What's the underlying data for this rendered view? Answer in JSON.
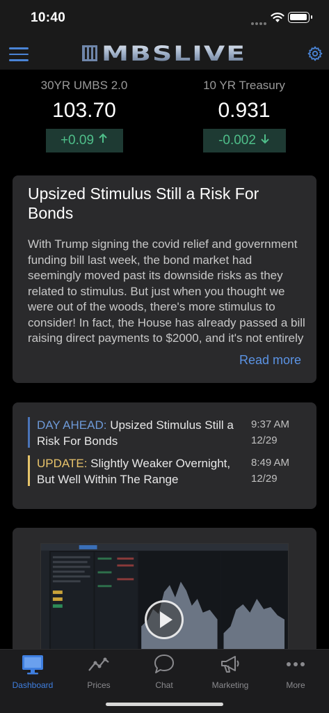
{
  "status": {
    "time": "10:40"
  },
  "header": {
    "brand": "MBSLIVE"
  },
  "quotes": [
    {
      "label": "30YR UMBS 2.0",
      "value": "103.70",
      "change": "+0.09",
      "direction": "up"
    },
    {
      "label": "10 YR Treasury",
      "value": "0.931",
      "change": "-0.002",
      "direction": "down"
    }
  ],
  "article": {
    "title": "Upsized Stimulus Still a Risk For Bonds",
    "body": "With Trump signing the covid relief and government funding bill last week, the bond market had seemingly moved past its downside risks as they related to stimulus. But just when you thought we were out of the woods, there's more stimulus to consider! In fact, the House has already passed a bill raising direct payments to $2000, and it's not entirely clear if the bill can",
    "read_more": "Read more"
  },
  "updates": [
    {
      "tag": "DAY AHEAD:",
      "text": "Upsized Stimulus Still a Risk For Bonds",
      "time": "9:37 AM",
      "date": "12/29"
    },
    {
      "tag": "UPDATE:",
      "text": "Slightly Weaker Overnight, But Well Within The Range",
      "time": "8:49 AM",
      "date": "12/29"
    }
  ],
  "tabs": [
    {
      "label": "Dashboard",
      "icon": "monitor-icon",
      "active": true
    },
    {
      "label": "Prices",
      "icon": "chart-line-icon",
      "active": false
    },
    {
      "label": "Chat",
      "icon": "chat-bubble-icon",
      "active": false
    },
    {
      "label": "Marketing",
      "icon": "megaphone-icon",
      "active": false
    },
    {
      "label": "More",
      "icon": "more-dots-icon",
      "active": false
    }
  ],
  "colors": {
    "accent": "#3f7fe0",
    "up": "#4fbf8a",
    "day_ahead_tag": "#6e9ad8",
    "update_tag": "#e8c36b"
  }
}
